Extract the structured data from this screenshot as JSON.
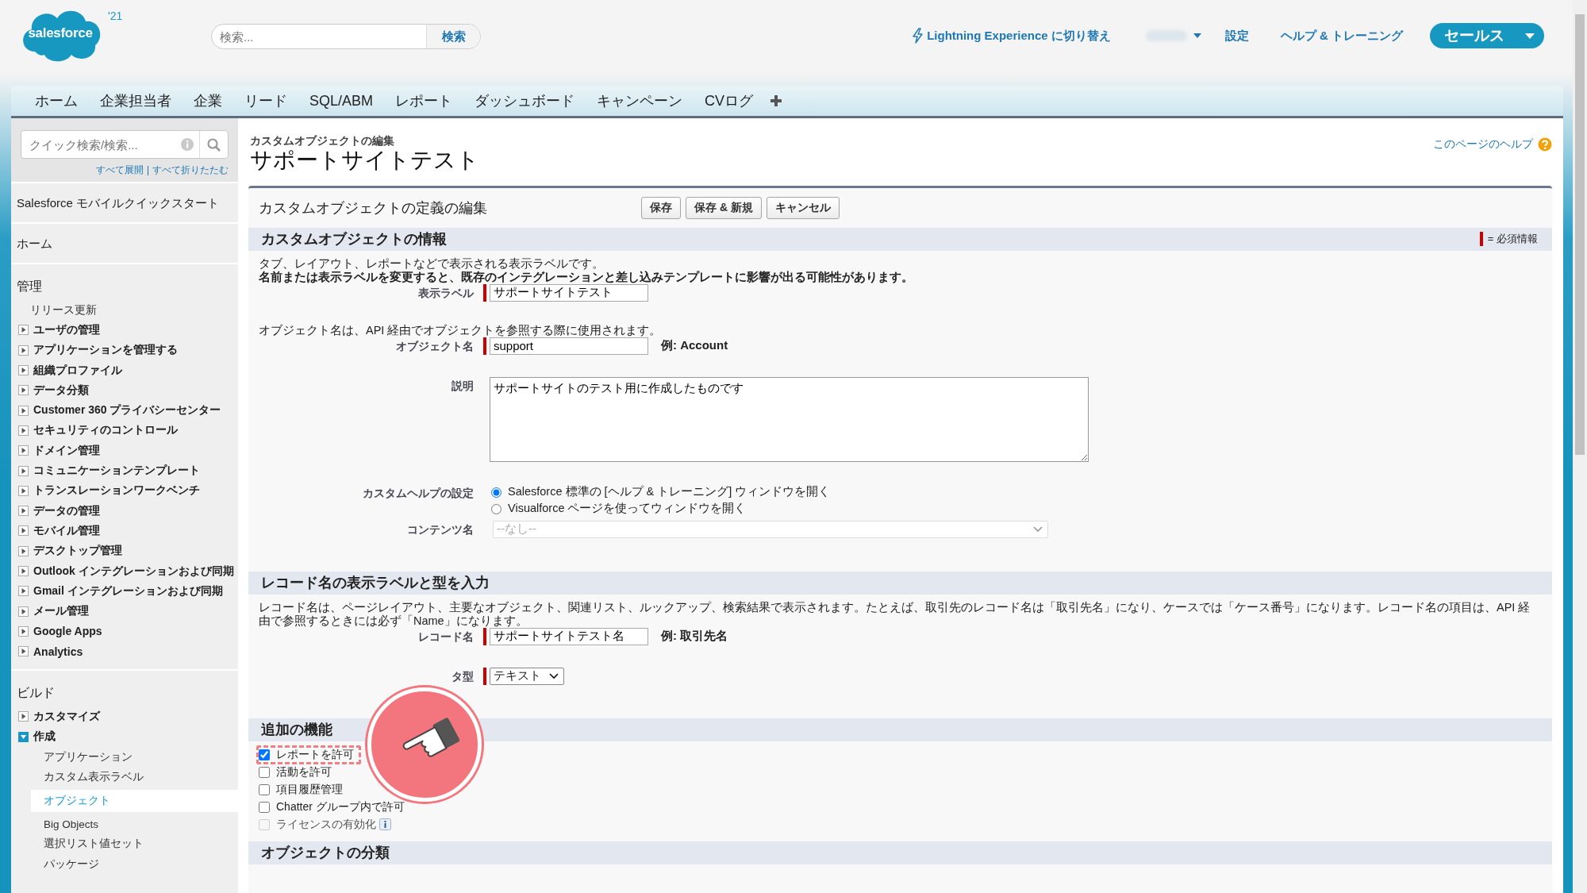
{
  "header": {
    "logo": "salesforce",
    "release_badge": "'21",
    "search": {
      "placeholder": "検索...",
      "button": "検索"
    },
    "lightning_link": "Lightning Experience に切り替え",
    "links": [
      "設定",
      "ヘルプ & トレーニング"
    ],
    "app_menu": "セールス"
  },
  "nav_tabs": [
    {
      "label": "ホーム",
      "selected": false
    },
    {
      "label": "企業担当者",
      "selected": false
    },
    {
      "label": "企業",
      "selected": false
    },
    {
      "label": "リード",
      "selected": false
    },
    {
      "label": "SQL/ABM",
      "selected": false
    },
    {
      "label": "レポート",
      "selected": false
    },
    {
      "label": "ダッシュボード",
      "selected": false
    },
    {
      "label": "キャンペーン",
      "selected": false
    },
    {
      "label": "CVログ",
      "selected": false
    }
  ],
  "sidebar": {
    "search_placeholder": "クイック検索/検索...",
    "expand_links": [
      "すべて展開",
      "すべて折りたたむ"
    ],
    "sections": [
      {
        "title": "Salesforce モバイルクイックスタート"
      },
      {
        "title": "ホーム"
      },
      {
        "title": "管理",
        "items": [
          {
            "kind": "link",
            "label": "リリース更新"
          },
          {
            "kind": "folder",
            "label": "ユーザの管理",
            "expanded": false
          },
          {
            "kind": "folder",
            "label": "アプリケーションを管理する",
            "expanded": false
          },
          {
            "kind": "folder",
            "label": "組織プロファイル",
            "expanded": false
          },
          {
            "kind": "folder",
            "label": "データ分類",
            "expanded": false
          },
          {
            "kind": "folder",
            "label": "Customer 360 プライバシーセンター",
            "expanded": false
          },
          {
            "kind": "folder",
            "label": "セキュリティのコントロール",
            "expanded": false
          },
          {
            "kind": "folder",
            "label": "ドメイン管理",
            "expanded": false
          },
          {
            "kind": "folder",
            "label": "コミュニケーションテンプレート",
            "expanded": false
          },
          {
            "kind": "folder",
            "label": "トランスレーションワークベンチ",
            "expanded": false
          },
          {
            "kind": "folder",
            "label": "データの管理",
            "expanded": false
          },
          {
            "kind": "folder",
            "label": "モバイル管理",
            "expanded": false
          },
          {
            "kind": "folder",
            "label": "デスクトップ管理",
            "expanded": false
          },
          {
            "kind": "folder",
            "label": "Outlook インテグレーションおよび同期",
            "expanded": false
          },
          {
            "kind": "folder",
            "label": "Gmail インテグレーションおよび同期",
            "expanded": false
          },
          {
            "kind": "folder",
            "label": "メール管理",
            "expanded": false
          },
          {
            "kind": "folder",
            "label": "Google Apps",
            "expanded": false
          },
          {
            "kind": "folder",
            "label": "Analytics",
            "expanded": false
          }
        ]
      },
      {
        "title": "ビルド",
        "items": [
          {
            "kind": "folder",
            "label": "カスタマイズ",
            "expanded": false
          },
          {
            "kind": "folder",
            "label": "作成",
            "expanded": true,
            "children": [
              {
                "label": "アプリケーション",
                "selected": false
              },
              {
                "label": "カスタム表示ラベル",
                "selected": false
              },
              {
                "label": "オブジェクト",
                "selected": true
              },
              {
                "label": "Big Objects",
                "selected": false
              },
              {
                "label": "選択リスト値セット",
                "selected": false
              },
              {
                "label": "パッケージ",
                "selected": false
              }
            ]
          }
        ]
      }
    ]
  },
  "page": {
    "breadcrumb": "カスタムオブジェクトの編集",
    "title": "サポートサイトテスト",
    "help_link": "このページのヘルプ"
  },
  "form": {
    "title": "カスタムオブジェクトの定義の編集",
    "buttons": [
      "保存",
      "保存 & 新規",
      "キャンセル"
    ],
    "sections": [
      {
        "title": "カスタムオブジェクトの情報",
        "legend": "= 必須情報",
        "rows": [
          {
            "kind": "text",
            "text": "タブ、レイアウト、レポートなどで表示される表示ラベルです。",
            "bold": false
          },
          {
            "kind": "text",
            "text": "名前または表示ラベルを変更すると、既存のインテグレーションと差し込みテンプレートに影響が出る可能性があります。",
            "bold": true
          },
          {
            "kind": "field",
            "label": "表示ラベル",
            "value": "サポートサイトテスト",
            "required": true
          },
          {
            "kind": "text",
            "text": "オブジェクト名は、API 経由でオブジェクトを参照する際に使用されます。",
            "bold": false
          },
          {
            "kind": "field",
            "label": "オブジェクト名",
            "value": "support",
            "required": true,
            "example": "例: Account"
          },
          {
            "kind": "textarea",
            "label": "説明",
            "value": "サポートサイトのテスト用に作成したものです"
          },
          {
            "kind": "radio",
            "label": "カスタムヘルプの設定",
            "options": [
              {
                "label": "Salesforce 標準の [ヘルプ & トレーニング] ウィンドウを開く",
                "selected": true
              },
              {
                "label": "Visualforce ページを使ってウィンドウを開く",
                "selected": false
              }
            ]
          },
          {
            "kind": "select",
            "label": "コンテンツ名",
            "value": "--なし--",
            "disabled": true,
            "required": false
          }
        ]
      },
      {
        "title": "レコード名の表示ラベルと型を入力",
        "rows": [
          {
            "kind": "text",
            "text": "レコード名は、ページレイアウト、主要なオブジェクト、関連リスト、ルックアップ、検索結果で表示されます。たとえば、取引先のレコード名は「取引先名」になり、ケースでは「ケース番号」になります。レコード名の項目は、API 経由で参照するときには必ず「Name」になります。",
            "bold": false
          },
          {
            "kind": "field",
            "label": "レコード名",
            "value": "サポートサイトテスト名",
            "required": true,
            "example": "例: 取引先名"
          },
          {
            "kind": "select",
            "label": "タ型",
            "value": "テキスト",
            "disabled": false,
            "required": true
          }
        ]
      },
      {
        "title": "追加の機能",
        "pointer_marker": true,
        "rows": [
          {
            "kind": "checkbox",
            "label": "レポートを許可",
            "checked": true,
            "disabled": false,
            "highlighted": true
          },
          {
            "kind": "checkbox",
            "label": "活動を許可",
            "checked": false,
            "disabled": false,
            "highlighted": false
          },
          {
            "kind": "checkbox",
            "label": "項目履歴管理",
            "checked": false,
            "disabled": false,
            "highlighted": false
          },
          {
            "kind": "checkbox",
            "label": "Chatter グループ内で許可",
            "checked": false,
            "disabled": false,
            "highlighted": false
          },
          {
            "kind": "checkbox",
            "label": "ライセンスの有効化",
            "checked": false,
            "disabled": true,
            "highlighted": false,
            "info": true
          }
        ]
      },
      {
        "title": "オブジェクトの分類"
      }
    ]
  }
}
